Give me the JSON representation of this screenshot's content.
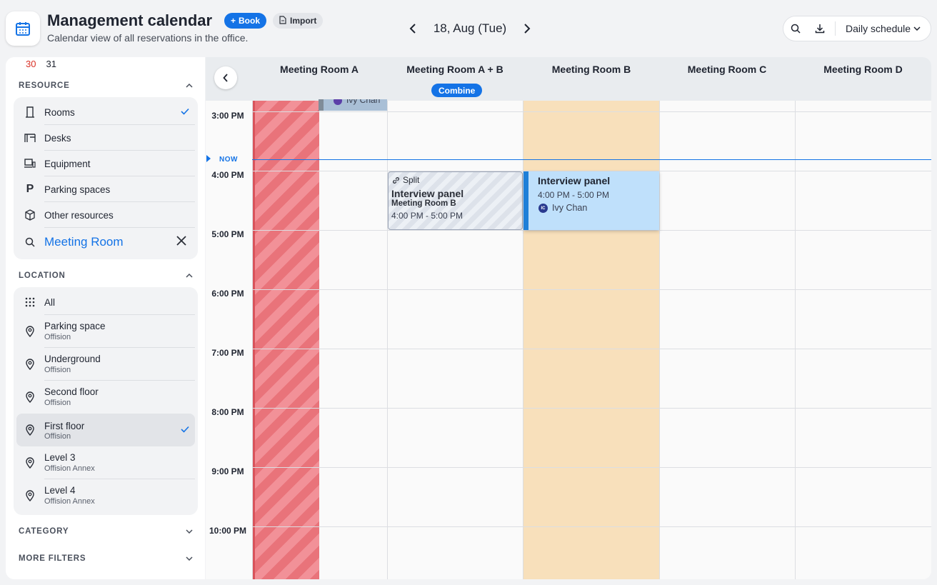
{
  "header": {
    "title": "Management calendar",
    "subtitle": "Calendar view of all reservations in the office.",
    "book_label": "Book",
    "import_label": "Import",
    "date": "18, Aug (Tue)",
    "schedule_view": "Daily schedule"
  },
  "sidebar": {
    "mini_days": [
      "30",
      "31"
    ],
    "resource": {
      "title": "RESOURCE",
      "items": [
        {
          "label": "Rooms",
          "icon": "door-icon",
          "selected": true
        },
        {
          "label": "Desks",
          "icon": "desk-icon"
        },
        {
          "label": "Equipment",
          "icon": "equipment-icon"
        },
        {
          "label": "Parking spaces",
          "icon": "parking-icon"
        },
        {
          "label": "Other resources",
          "icon": "box-icon"
        }
      ],
      "search_value": "Meeting Room"
    },
    "location": {
      "title": "LOCATION",
      "items": [
        {
          "label": "All",
          "sub": ""
        },
        {
          "label": "Parking space",
          "sub": "Offision"
        },
        {
          "label": "Underground",
          "sub": "Offision"
        },
        {
          "label": "Second floor",
          "sub": "Offision"
        },
        {
          "label": "First floor",
          "sub": "Offision",
          "selected": true
        },
        {
          "label": "Level 3",
          "sub": "Offision Annex"
        },
        {
          "label": "Level 4",
          "sub": "Offision Annex"
        }
      ]
    },
    "category_title": "CATEGORY",
    "more_filters_title": "MORE FILTERS"
  },
  "calendar": {
    "rooms": [
      "Meeting Room A",
      "Meeting Room A + B",
      "Meeting Room B",
      "Meeting Room C",
      "Meeting Room D"
    ],
    "combine_badge": "Combine",
    "times": [
      "3:00 PM",
      "4:00 PM",
      "5:00 PM",
      "6:00 PM",
      "7:00 PM",
      "8:00 PM",
      "9:00 PM",
      "10:00 PM"
    ],
    "now_label": "NOW",
    "previous_event": {
      "person": "Ivy Chan"
    },
    "split_event": {
      "tag": "Split",
      "title": "Interview panel",
      "room": "Meeting Room B",
      "time": "4:00 PM - 5:00 PM"
    },
    "main_event": {
      "title": "Interview panel",
      "time": "4:00 PM - 5:00 PM",
      "initials": "IC",
      "person": "Ivy Chan"
    }
  },
  "colors": {
    "accent": "#1473e6",
    "blocked": "#e9737a",
    "highlight": "#f8e0bb",
    "event": "#bfe0fb"
  }
}
